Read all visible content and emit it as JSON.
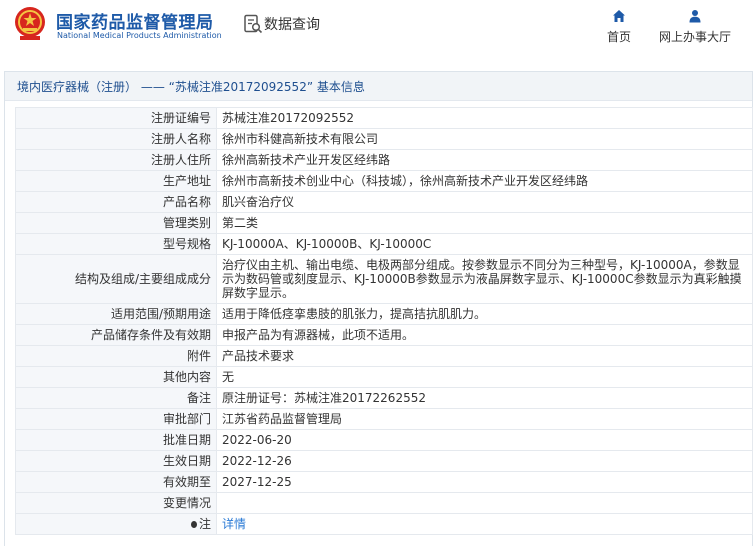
{
  "header": {
    "logo_cn": "国家药品监督管理局",
    "logo_en": "National Medical Products Administration",
    "page_title": "数据查询",
    "nav": [
      {
        "label": "首页",
        "icon": "home-icon"
      },
      {
        "label": "网上办事大厅",
        "icon": "user-icon"
      }
    ]
  },
  "breadcrumb": "境内医疗器械（注册） —— “苏械注准20172092552” 基本信息",
  "rows": [
    {
      "label": "注册证编号",
      "value": "苏械注准20172092552"
    },
    {
      "label": "注册人名称",
      "value": "徐州市科健高新技术有限公司"
    },
    {
      "label": "注册人住所",
      "value": "徐州高新技术产业开发区经纬路"
    },
    {
      "label": "生产地址",
      "value": "徐州市高新技术创业中心（科技城），徐州高新技术产业开发区经纬路"
    },
    {
      "label": "产品名称",
      "value": "肌兴奋治疗仪"
    },
    {
      "label": "管理类别",
      "value": "第二类"
    },
    {
      "label": "型号规格",
      "value": "KJ-10000A、KJ-10000B、KJ-10000C"
    },
    {
      "label": "结构及组成/主要组成成分",
      "value": "治疗仪由主机、输出电缆、电极两部分组成。按参数显示不同分为三种型号，KJ-10000A，参数显示为数码管或刻度显示、KJ-10000B参数显示为液晶屏数字显示、KJ-10000C参数显示为真彩触摸屏数字显示。"
    },
    {
      "label": "适用范围/预期用途",
      "value": "适用于降低痉挛患肢的肌张力，提高拮抗肌肌力。"
    },
    {
      "label": "产品储存条件及有效期",
      "value": "申报产品为有源器械，此项不适用。"
    },
    {
      "label": "附件",
      "value": "产品技术要求"
    },
    {
      "label": "其他内容",
      "value": "无"
    },
    {
      "label": "备注",
      "value": "原注册证号：苏械注准20172262552"
    },
    {
      "label": "审批部门",
      "value": "江苏省药品监督管理局"
    },
    {
      "label": "批准日期",
      "value": "2022-06-20"
    },
    {
      "label": "生效日期",
      "value": "2022-12-26"
    },
    {
      "label": "有效期至",
      "value": "2027-12-25"
    },
    {
      "label": "变更情况",
      "value": ""
    }
  ],
  "note": {
    "label": "注",
    "icon": "lightbulb-icon",
    "link": "详情"
  },
  "colors": {
    "brand_blue": "#1e5aa8",
    "link_blue": "#2b7bd6",
    "emblem_red": "#d7261e"
  }
}
